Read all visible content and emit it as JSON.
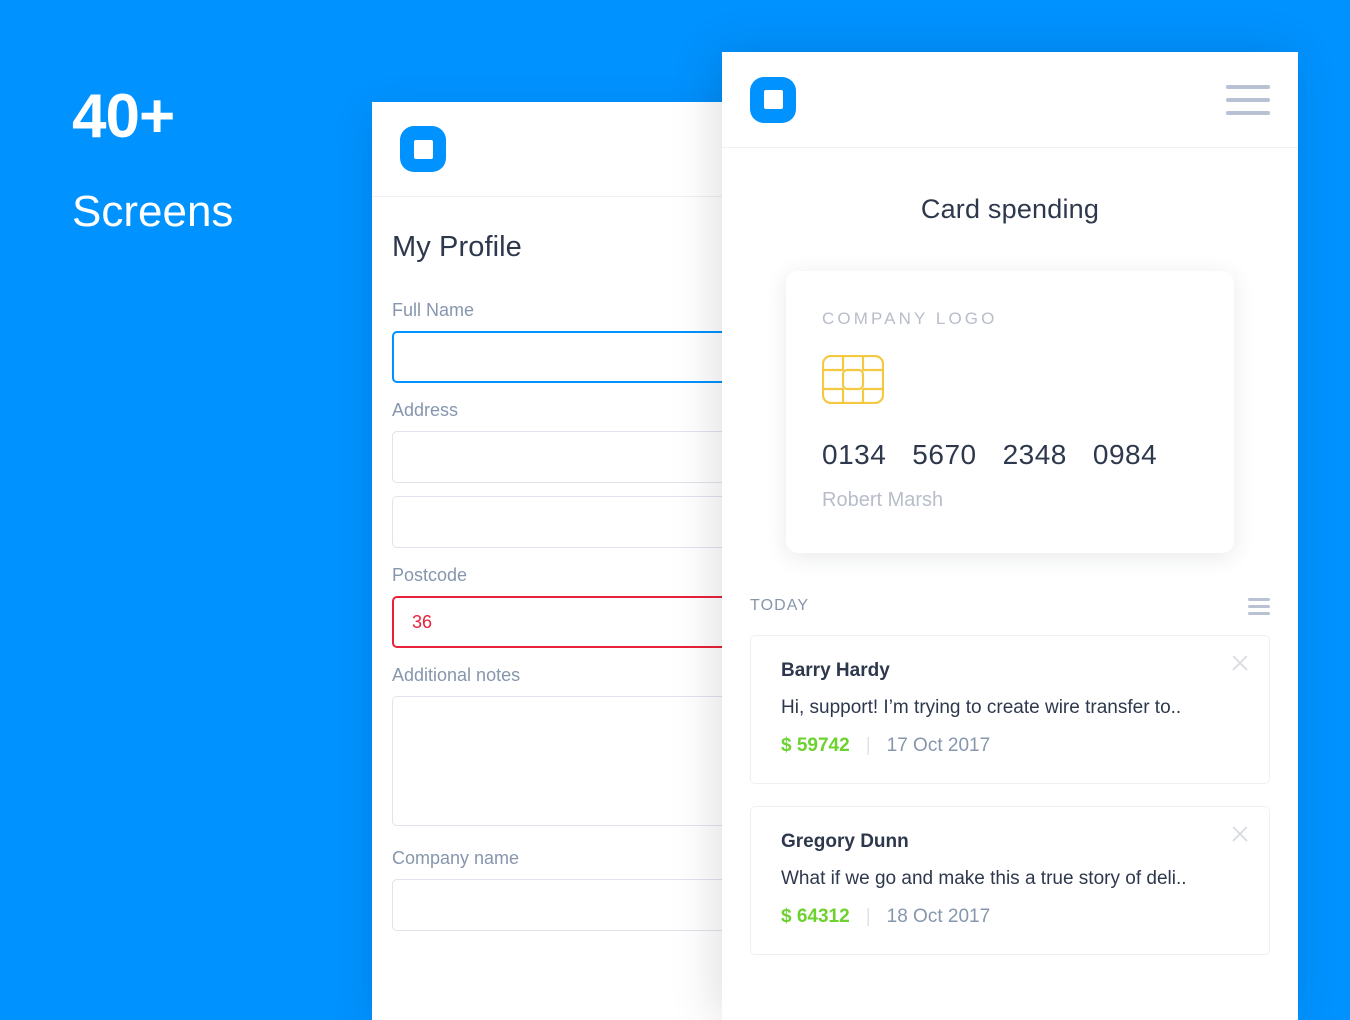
{
  "theme": {
    "background": "#0092ff",
    "accent": "#0092ff",
    "text_dark": "#2e384d",
    "text_muted": "#8696ad",
    "error": "#e8223a",
    "success": "#6dd230",
    "chip_gold": "#f5c842"
  },
  "promo": {
    "number": "40+",
    "label": "Screens"
  },
  "profile_screen": {
    "appbar": {
      "logo_icon": "app-logo-square-icon"
    },
    "title": "My Profile",
    "fields": [
      {
        "label": "Full Name",
        "value": "",
        "placeholder": "",
        "state": "focused",
        "type": "text"
      },
      {
        "label": "Address",
        "value": "",
        "placeholder": "",
        "state": "normal",
        "type": "text"
      },
      {
        "label": "",
        "value": "",
        "placeholder": "",
        "state": "normal",
        "type": "text"
      },
      {
        "label": "Postcode",
        "value": "36",
        "placeholder": "",
        "state": "error",
        "type": "text"
      },
      {
        "label": "Additional notes",
        "value": "",
        "placeholder": "",
        "state": "normal",
        "type": "textarea"
      },
      {
        "label": "Company name",
        "value": "",
        "placeholder": "",
        "state": "normal",
        "type": "text"
      }
    ]
  },
  "spending_screen": {
    "appbar": {
      "logo_icon": "app-logo-square-icon",
      "menu_icon": "hamburger-menu-icon"
    },
    "title": "Card spending",
    "card": {
      "company_label": "COMPANY LOGO",
      "chip_icon": "emv-chip-icon",
      "number_groups": [
        "0134",
        "5670",
        "2348",
        "0984"
      ],
      "holder_name": "Robert Marsh"
    },
    "transactions": {
      "section_label": "TODAY",
      "filter_icon": "filter-list-icon",
      "items": [
        {
          "name": "Barry Hardy",
          "message": "Hi, support! I’m trying to create wire transfer to..",
          "amount": "$ 59742",
          "separator": "|",
          "date": "17 Oct 2017",
          "close_icon": "close-x-icon"
        },
        {
          "name": "Gregory Dunn",
          "message": "What if we go and make this a true story of deli..",
          "amount": "$ 64312",
          "separator": "|",
          "date": "18 Oct 2017",
          "close_icon": "close-x-icon"
        }
      ]
    }
  }
}
